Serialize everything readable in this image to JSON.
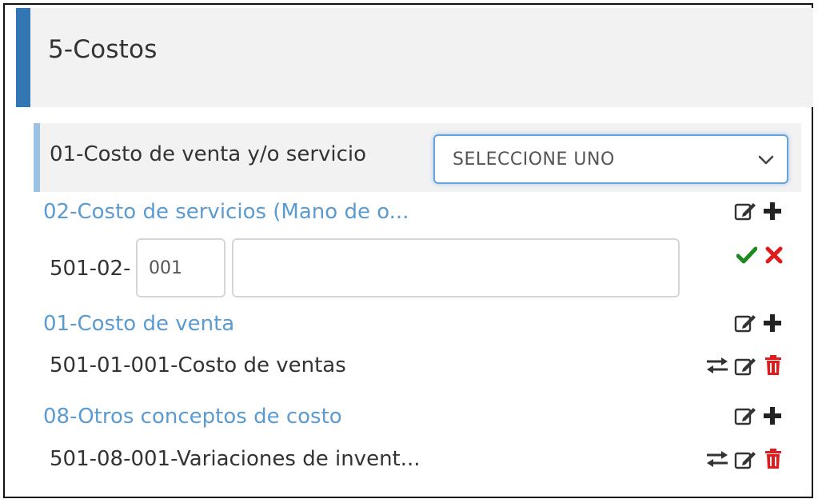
{
  "panel": {
    "title": "5-Costos"
  },
  "group": {
    "label": "01-Costo de venta y/o servicio",
    "select_value": "SELECCIONE UNO"
  },
  "sections": [
    {
      "title": "02-Costo de servicios (Mano de o...",
      "new_account": {
        "prefix": "501-02-",
        "code_value": "001",
        "name_value": ""
      }
    },
    {
      "title": "01-Costo de venta",
      "accounts": [
        "501-01-001-Costo de ventas"
      ]
    },
    {
      "title": "08-Otros conceptos de costo",
      "accounts": [
        "501-08-001-Variaciones de invent..."
      ]
    }
  ],
  "icons": {
    "edit": "edit-icon",
    "add": "plus-icon",
    "confirm": "check-icon",
    "cancel": "close-icon",
    "transfer": "transfer-icon",
    "delete": "trash-icon",
    "dropdown": "chevron-down-icon"
  },
  "colors": {
    "accent": "#3277b3",
    "link": "#5b9bd0",
    "confirm": "#1e8a1e",
    "danger": "#e11b1b"
  }
}
